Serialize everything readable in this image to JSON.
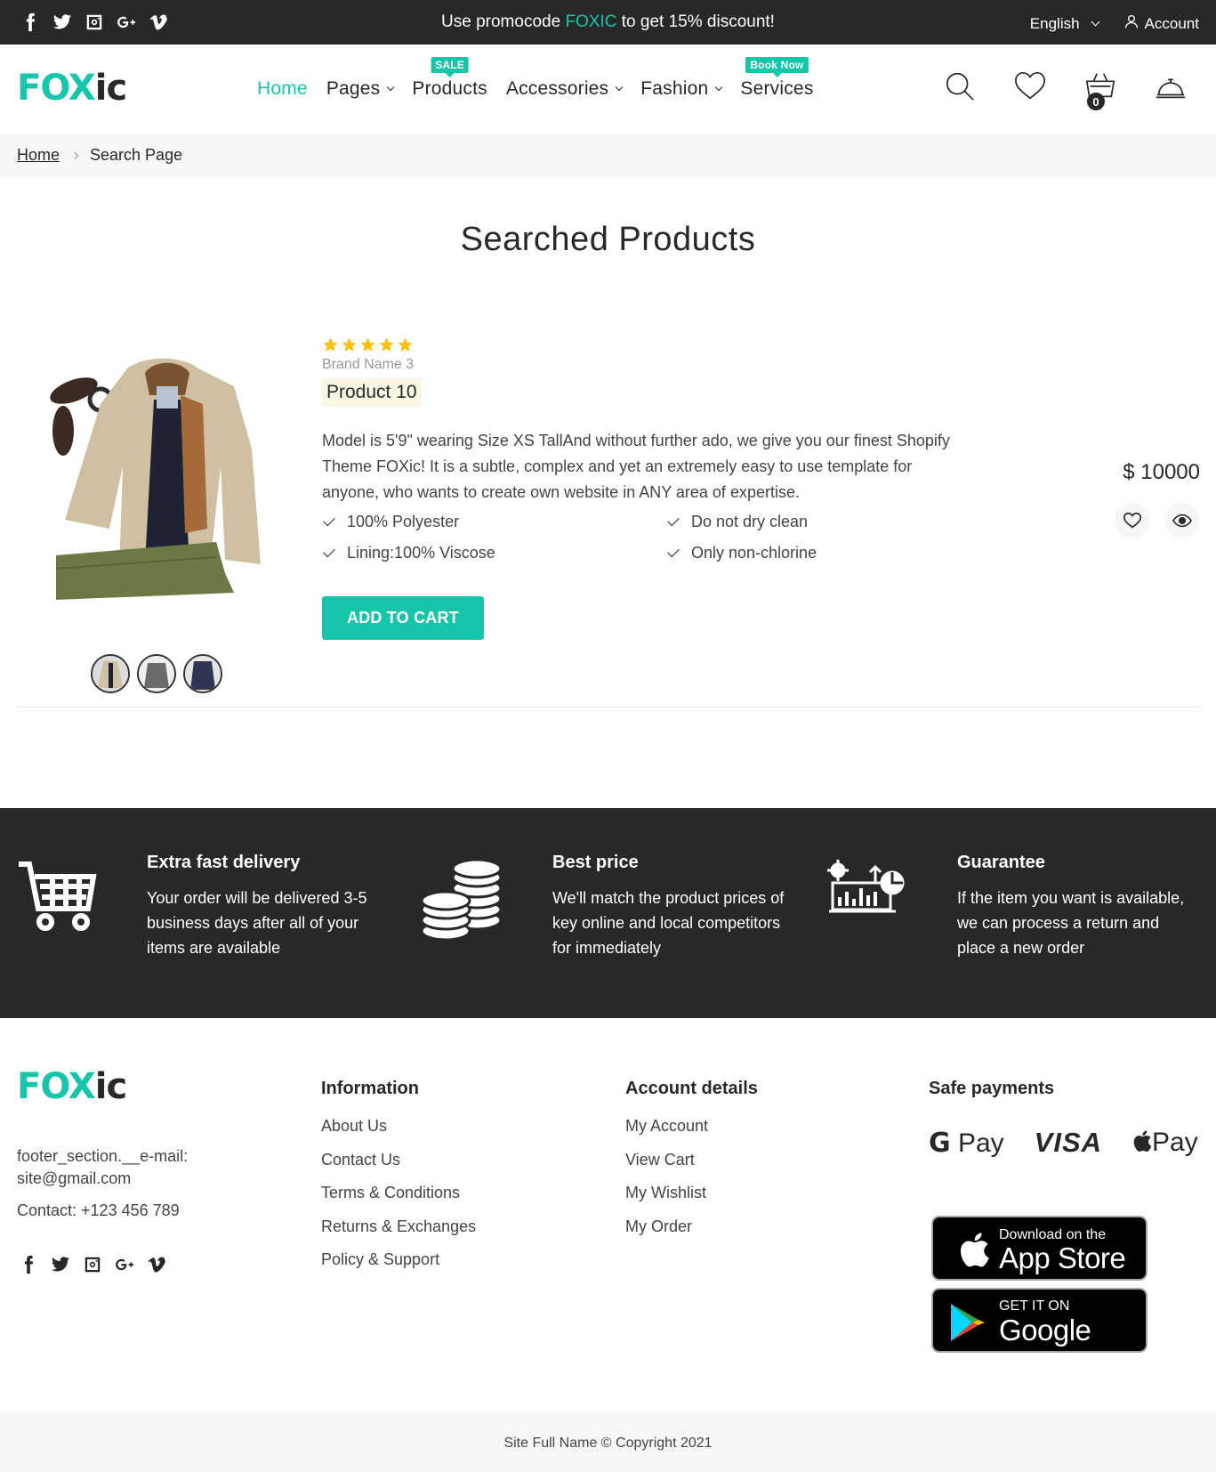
{
  "topbar": {
    "promo_prefix": "Use promocode ",
    "promo_code": "FOXIC",
    "promo_suffix": " to get 15% discount!",
    "language": "English",
    "account": "Account"
  },
  "logo": {
    "part1": "FOX",
    "part2": "ic"
  },
  "nav": {
    "items": [
      {
        "label": "Home",
        "active": true
      },
      {
        "label": "Pages",
        "dropdown": true
      },
      {
        "label": "Products",
        "badge": "SALE"
      },
      {
        "label": "Accessories",
        "dropdown": true
      },
      {
        "label": "Fashion",
        "dropdown": true
      },
      {
        "label": "Services",
        "badge": "Book Now"
      }
    ]
  },
  "header": {
    "cart_count": "0"
  },
  "breadcrumb": {
    "home": "Home",
    "current": "Search Page"
  },
  "page": {
    "title": "Searched Products"
  },
  "product": {
    "rating": 5,
    "brand": "Brand Name 3",
    "name": "Product 10",
    "description": "Model is 5'9\" wearing Size XS TallAnd without further ado, we give you our finest Shopify Theme FOXic! It is a subtle, complex and yet an extremely easy to use template for anyone, who wants to create own website in ANY area of expertise.",
    "features": [
      "100% Polyester",
      "Do not dry clean",
      "Lining:100% Viscose",
      "Only non-chlorine"
    ],
    "add_to_cart": "ADD TO CART",
    "price": "$ 10000"
  },
  "band": {
    "items": [
      {
        "title": "Extra fast delivery",
        "text": "Your order will be delivered 3-5 business days after all of your items are available",
        "icon": "cart-icon"
      },
      {
        "title": "Best price",
        "text": "We'll match the product prices of key online and local competitors for immediately",
        "icon": "coins-icon"
      },
      {
        "title": "Guarantee",
        "text": "If the item you want is available, we can process a return and place a new order",
        "icon": "chart-icon"
      }
    ]
  },
  "footer": {
    "email_label": "footer_section.__e-mail:",
    "email": "site@gmail.com",
    "contact": "Contact: +123 456 789",
    "information": {
      "title": "Information",
      "links": [
        "About Us",
        "Contact Us",
        "Terms & Conditions",
        "Returns & Exchanges",
        "Policy & Support"
      ]
    },
    "account": {
      "title": "Account details",
      "links": [
        "My Account",
        "View Cart",
        "My Wishlist",
        "My Order"
      ]
    },
    "payments": {
      "title": "Safe payments",
      "gpay": "Pay",
      "visa": "VISA",
      "applepay": "Pay"
    },
    "appstore": {
      "line1": "Download on the",
      "line2": "App Store"
    },
    "googleplay": {
      "line1": "GET IT ON",
      "line2": "Google Play"
    },
    "copyright": "Site Full Name © Copyright 2021"
  },
  "colors": {
    "accent": "#17c6aa",
    "dark": "#282828",
    "star": "#f7c10c"
  }
}
